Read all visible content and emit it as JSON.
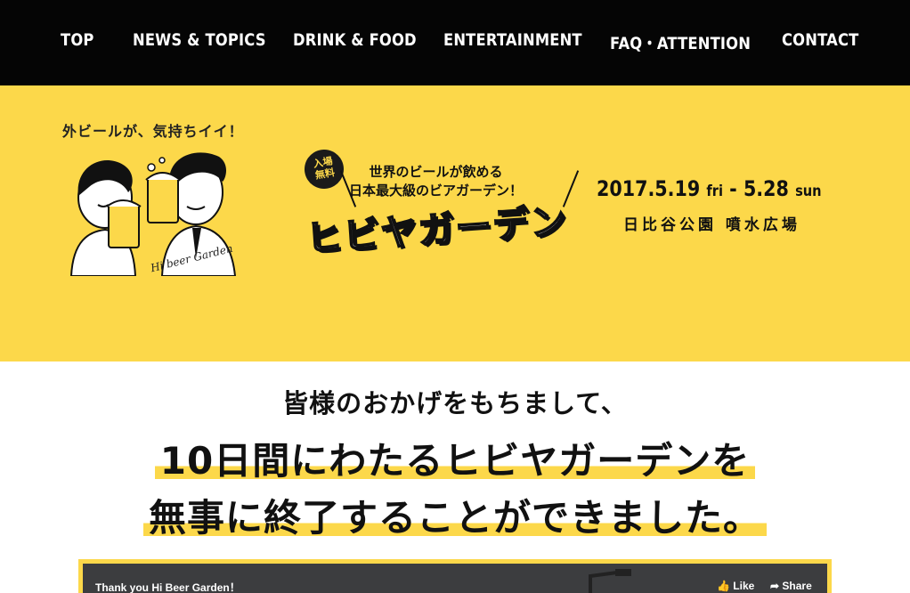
{
  "nav": {
    "items": [
      "TOP",
      "NEWS & TOPICS",
      "DRINK & FOOD",
      "ENTERTAINMENT",
      "FAQ・ATTENTION",
      "CONTACT"
    ]
  },
  "hero": {
    "tagline": "外ビールが、気持ちイイ！",
    "mascot_caption": "Hi beer Garden",
    "badge": "入場\n無料",
    "catch_line1": "世界のビールが飲める",
    "catch_line2": "日本最大級のビアガーデン！",
    "logo": "ヒビヤガーデン",
    "date_start": "2017.5.19",
    "date_start_day": "fri",
    "date_sep": "-",
    "date_end": "5.28",
    "date_end_day": "sun",
    "venue": "日比谷公園 噴水広場"
  },
  "message": {
    "thanks": "皆様のおかげをもちまして、",
    "line1": "10日間にわたるヒビヤガーデンを",
    "line2": "無事に終了することができました。"
  },
  "video": {
    "title": "Thank you Hi Beer Garden！",
    "like": "Like",
    "share": "Share"
  },
  "colors": {
    "nav_bg": "#050505",
    "accent_yellow": "#fcd84a",
    "text": "#111111"
  }
}
